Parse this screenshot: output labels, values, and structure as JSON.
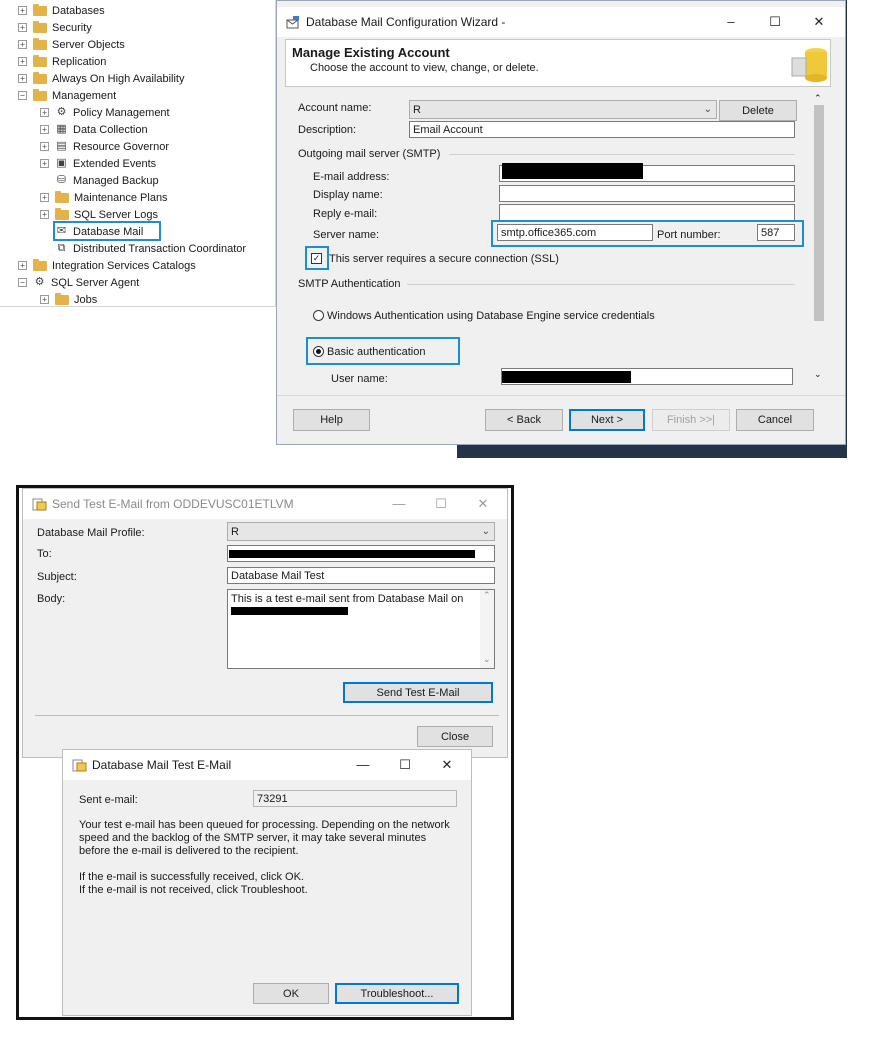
{
  "tree": {
    "items": [
      {
        "label": "Databases",
        "exp": "+",
        "icon": "folder",
        "level": 0
      },
      {
        "label": "Security",
        "exp": "+",
        "icon": "folder",
        "level": 0
      },
      {
        "label": "Server Objects",
        "exp": "+",
        "icon": "folder",
        "level": 0
      },
      {
        "label": "Replication",
        "exp": "+",
        "icon": "folder",
        "level": 0
      },
      {
        "label": "Always On High Availability",
        "exp": "+",
        "icon": "folder",
        "level": 0
      },
      {
        "label": "Management",
        "exp": "−",
        "icon": "folder",
        "level": 0
      },
      {
        "label": "Policy Management",
        "exp": "+",
        "icon": "policy",
        "level": 1
      },
      {
        "label": "Data Collection",
        "exp": "+",
        "icon": "datacollect",
        "level": 1
      },
      {
        "label": "Resource Governor",
        "exp": "+",
        "icon": "resource",
        "level": 1
      },
      {
        "label": "Extended Events",
        "exp": "+",
        "icon": "events",
        "level": 1
      },
      {
        "label": "Managed Backup",
        "exp": "",
        "icon": "backup",
        "level": 1
      },
      {
        "label": "Maintenance Plans",
        "exp": "+",
        "icon": "folder",
        "level": 1
      },
      {
        "label": "SQL Server Logs",
        "exp": "+",
        "icon": "folder",
        "level": 1
      },
      {
        "label": "Database Mail",
        "exp": "",
        "icon": "mail",
        "level": 1
      },
      {
        "label": "Distributed Transaction Coordinator",
        "exp": "",
        "icon": "dtc",
        "level": 1
      },
      {
        "label": "Integration Services Catalogs",
        "exp": "+",
        "icon": "folder",
        "level": 0
      },
      {
        "label": "SQL Server Agent",
        "exp": "−",
        "icon": "agent",
        "level": 0
      },
      {
        "label": "Jobs",
        "exp": "+",
        "icon": "folder",
        "level": 1
      }
    ]
  },
  "wizard": {
    "title": "Database Mail Configuration Wizard -",
    "heading": "Manage Existing Account",
    "subheading": "Choose the account to view, change, or delete.",
    "account_name_label": "Account name:",
    "account_name_value": "R",
    "delete_label": "Delete",
    "description_label": "Description:",
    "description_value": "Email Account",
    "smtp_group": "Outgoing mail server (SMTP)",
    "email_label": "E-mail address:",
    "display_label": "Display name:",
    "reply_label": "Reply e-mail:",
    "server_label": "Server name:",
    "server_value": "smtp.office365.com",
    "port_label": "Port number:",
    "port_value": "587",
    "ssl_label": "This server requires a secure connection (SSL)",
    "smtp_auth_group": "SMTP Authentication",
    "windows_auth_label": "Windows Authentication using Database Engine service credentials",
    "basic_auth_label": "Basic authentication",
    "username_label": "User name:",
    "help_label": "Help",
    "back_label": "< Back",
    "next_label": "Next >",
    "finish_label": "Finish >>|",
    "cancel_label": "Cancel",
    "min": "–",
    "max": "☐",
    "close": "✕"
  },
  "sendtest": {
    "title": "Send Test E-Mail from ODDEVUSC01ETLVM",
    "profile_label": "Database Mail Profile:",
    "profile_value": "R",
    "to_label": "To:",
    "subject_label": "Subject:",
    "subject_value": "Database Mail Test",
    "body_label": "Body:",
    "body_value": "This is a test e-mail sent from Database Mail on",
    "send_label": "Send Test E-Mail",
    "close_label": "Close",
    "min": "—",
    "max": "☐",
    "close": "✕"
  },
  "testmail": {
    "title": "Database Mail Test E-Mail",
    "sent_label": "Sent e-mail:",
    "sent_value": "73291",
    "msg1": "Your test e-mail has been queued for processing.  Depending on the network",
    "msg2": "speed and the backlog of the SMTP server, it may take several minutes",
    "msg3": "before the e-mail is delivered to the recipient.",
    "msg4": "If the e-mail is successfully received, click OK.",
    "msg5": "If the e-mail is not received, click Troubleshoot.",
    "ok_label": "OK",
    "troubleshoot_label": "Troubleshoot...",
    "min": "—",
    "max": "☐",
    "close": "✕"
  }
}
